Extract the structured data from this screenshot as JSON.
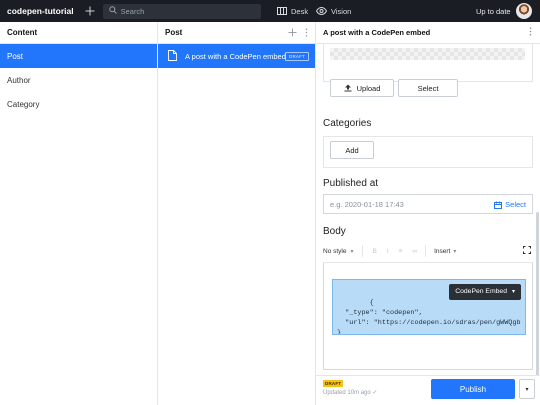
{
  "topbar": {
    "brand": "codepen-tutorial",
    "search_placeholder": "Search",
    "desk_label": "Desk",
    "vision_label": "Vision",
    "status": "Up to date"
  },
  "content_pane": {
    "title": "Content",
    "items": [
      {
        "label": "Post",
        "selected": true
      },
      {
        "label": "Author",
        "selected": false
      },
      {
        "label": "Category",
        "selected": false
      }
    ]
  },
  "post_pane": {
    "title": "Post",
    "items": [
      {
        "title": "A post with a CodePen embed",
        "badge": "DRAFT"
      }
    ]
  },
  "document": {
    "title": "A post with a CodePen embed",
    "image_field": {
      "upload_label": "Upload",
      "select_label": "Select"
    },
    "categories": {
      "title": "Categories",
      "add_label": "Add"
    },
    "published_at": {
      "title": "Published at",
      "placeholder": "e.g. 2020-01-18 17:43",
      "select_label": "Select"
    },
    "body": {
      "title": "Body",
      "style_select": "No style",
      "insert_label": "Insert",
      "embed_label": "CodePen Embed",
      "embed_code": "{\n  \"_type\": \"codepen\",\n  \"url\": \"https://codepen.io/sdras/pen/gWWQgb\n}"
    },
    "footer": {
      "badge": "DRAFT",
      "updated": "Updated 10m ago ✓",
      "publish_label": "Publish"
    }
  },
  "colors": {
    "accent": "#2276fc",
    "topbar": "#1a1d23",
    "draft": "#f5c118",
    "embed_bg": "#b8dcf7"
  }
}
